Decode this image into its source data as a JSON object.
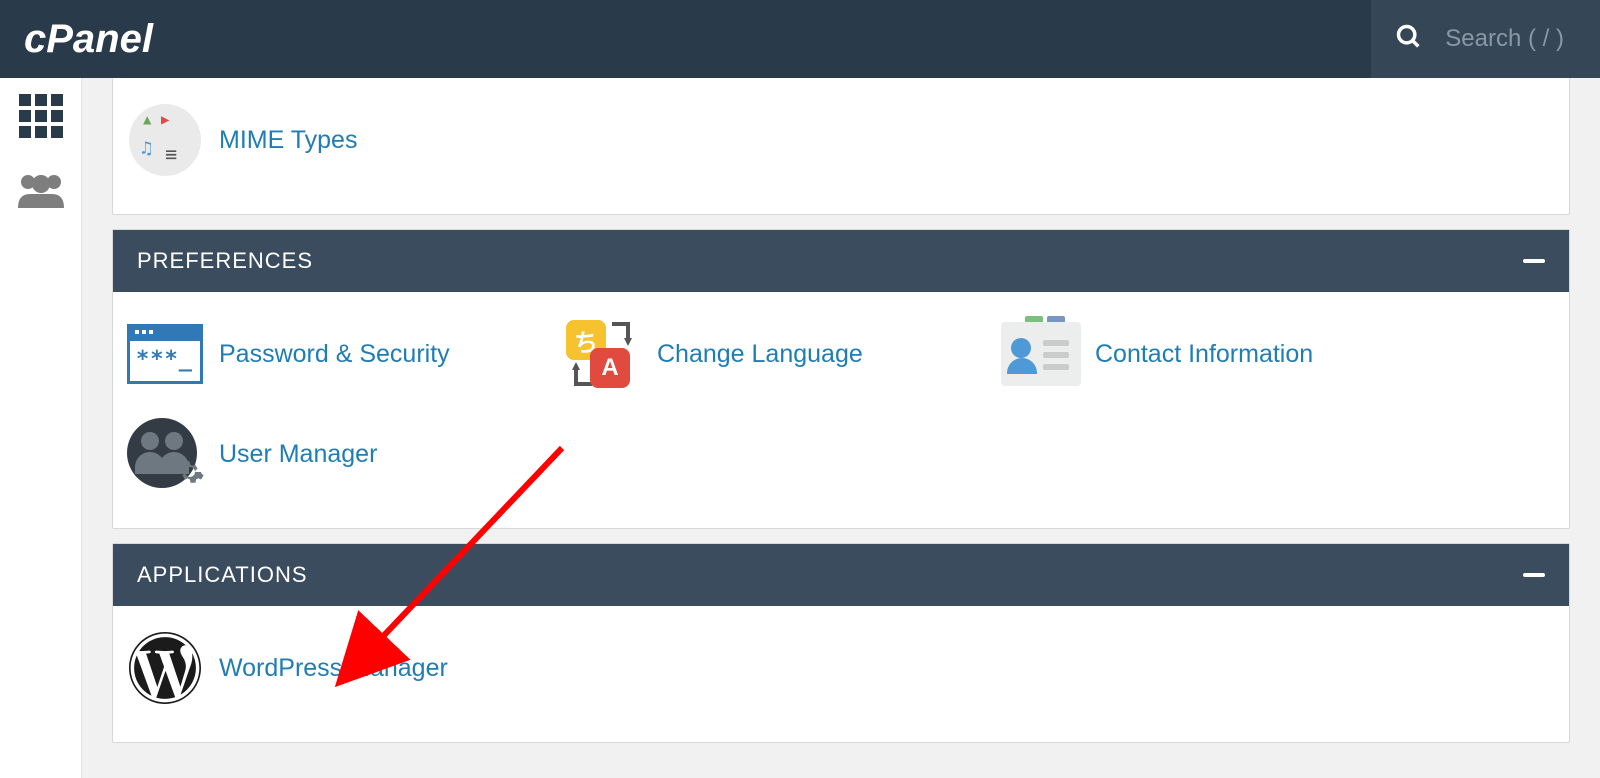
{
  "header": {
    "logo_text": "cPanel",
    "search_placeholder": "Search ( / )"
  },
  "sidebar": {
    "home_label": "home-grid",
    "users_label": "users"
  },
  "panels": [
    {
      "id": "partial",
      "title": "",
      "items": [
        {
          "id": "mime",
          "label": "MIME Types"
        }
      ]
    },
    {
      "id": "preferences",
      "title": "PREFERENCES",
      "items": [
        {
          "id": "password",
          "label": "Password & Security"
        },
        {
          "id": "language",
          "label": "Change Language"
        },
        {
          "id": "contact",
          "label": "Contact Information"
        },
        {
          "id": "usermgr",
          "label": "User Manager"
        }
      ]
    },
    {
      "id": "applications",
      "title": "APPLICATIONS",
      "items": [
        {
          "id": "wordpress",
          "label": "WordPress Manager"
        }
      ]
    }
  ],
  "annotation": {
    "target": "wordpress"
  },
  "colors": {
    "link": "#1f7db5",
    "panel_header": "#3a4c5d",
    "topbar": "#293a4a"
  }
}
